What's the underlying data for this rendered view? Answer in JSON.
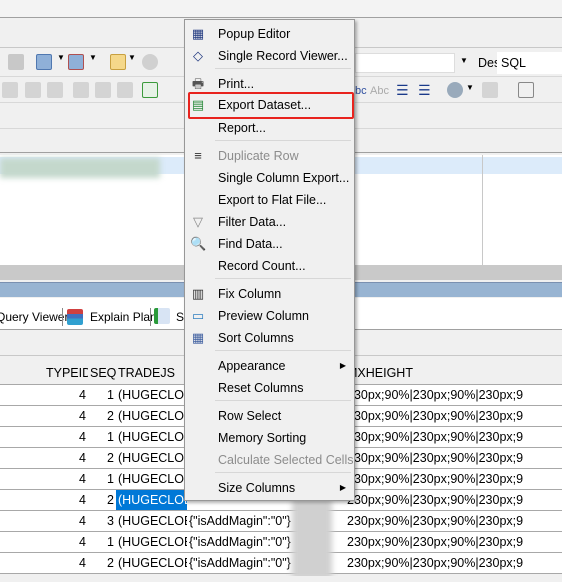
{
  "toolbar": {
    "desktop_label": "Desktop:",
    "desktop_value": "SQL"
  },
  "tabs": [
    {
      "label": "Query Viewer"
    },
    {
      "label": "Explain Plan"
    },
    {
      "label": "S"
    }
  ],
  "grid": {
    "columns": [
      "TYPEID",
      "SEQ",
      "TRADEJS",
      "",
      "MXHEIGHT"
    ],
    "rows": [
      {
        "typeid": "4",
        "seq": "1",
        "tradejs": "(HUGECLO",
        "col4": "",
        "mxheight": "230px;90%|230px;90%|230px;9"
      },
      {
        "typeid": "4",
        "seq": "2",
        "tradejs": "(HUGECLO",
        "col4": "",
        "mxheight": "230px;90%|230px;90%|230px;9"
      },
      {
        "typeid": "4",
        "seq": "1",
        "tradejs": "(HUGECLO",
        "col4": "",
        "mxheight": "230px;90%|230px;90%|230px;9"
      },
      {
        "typeid": "4",
        "seq": "2",
        "tradejs": "(HUGECLO",
        "col4": "",
        "mxheight": "230px;90%|230px;90%|230px;9"
      },
      {
        "typeid": "4",
        "seq": "1",
        "tradejs": "(HUGECLO",
        "col4": "",
        "mxheight": "230px;90%|230px;90%|230px;9"
      },
      {
        "typeid": "4",
        "seq": "2",
        "tradejs": "(HUGECLOB)",
        "col4": "",
        "mxheight": "230px;90%|230px;90%|230px;9",
        "selected": true
      },
      {
        "typeid": "4",
        "seq": "3",
        "tradejs": "(HUGECLOB)",
        "col4": "{\"isAddMagin\":\"0\"}",
        "mxheight": "230px;90%|230px;90%|230px;9"
      },
      {
        "typeid": "4",
        "seq": "1",
        "tradejs": "(HUGECLOB)",
        "col4": "{\"isAddMagin\":\"0\"}",
        "mxheight": "230px;90%|230px;90%|230px;9"
      },
      {
        "typeid": "4",
        "seq": "2",
        "tradejs": "(HUGECLOB)",
        "col4": "{\"isAddMagin\":\"0\"}",
        "mxheight": "230px;90%|230px;90%|230px;9"
      }
    ]
  },
  "context_menu": {
    "items": [
      {
        "label": "Popup Editor",
        "icon": "grid-icon"
      },
      {
        "label": "Single Record Viewer...",
        "icon": "book-icon"
      },
      {
        "label": "Print...",
        "icon": "printer-icon"
      },
      {
        "label": "Export Dataset...",
        "icon": "export-icon",
        "highlighted": true
      },
      {
        "label": "Report...",
        "icon": ""
      },
      {
        "label": "Duplicate Row",
        "icon": "duplicate-row-icon",
        "disabled": true
      },
      {
        "label": "Single Column Export...",
        "icon": ""
      },
      {
        "label": "Export to Flat File...",
        "icon": ""
      },
      {
        "label": "Filter Data...",
        "icon": "funnel-icon"
      },
      {
        "label": "Find Data...",
        "icon": "magnifier-icon"
      },
      {
        "label": "Record Count...",
        "icon": ""
      },
      {
        "label": "Fix Column",
        "icon": "fix-column-icon"
      },
      {
        "label": "Preview Column",
        "icon": "preview-column-icon"
      },
      {
        "label": "Sort Columns",
        "icon": "sort-columns-icon"
      },
      {
        "label": "Appearance",
        "icon": "",
        "submenu": true
      },
      {
        "label": "Reset Columns",
        "icon": ""
      },
      {
        "label": "Row Select",
        "icon": ""
      },
      {
        "label": "Memory Sorting",
        "icon": ""
      },
      {
        "label": "Calculate Selected Cells",
        "icon": "",
        "disabled": true
      },
      {
        "label": "Size Columns",
        "icon": "",
        "submenu": true
      }
    ]
  },
  "colors": {
    "highlight_box": "#e8231e",
    "selection": "#0078d7",
    "panel_header": "#98b4d2"
  }
}
